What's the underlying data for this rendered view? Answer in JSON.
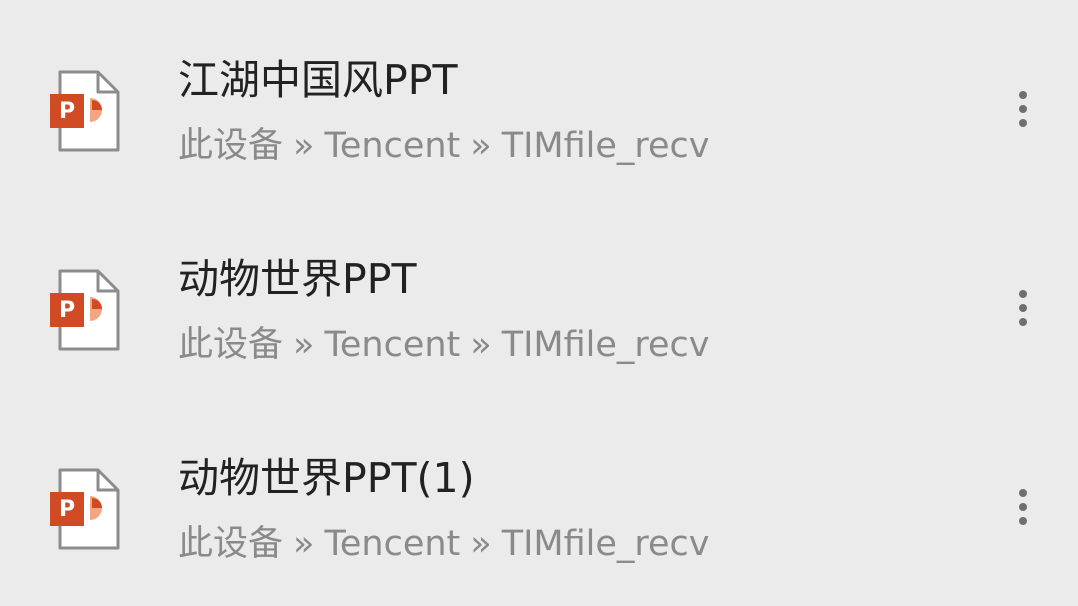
{
  "colors": {
    "background": "#ebebeb",
    "title_text": "#222222",
    "path_text": "#8a8a8a",
    "ppt_orange": "#d04a23",
    "ppt_light": "#f4a682"
  },
  "files": [
    {
      "icon": "ppt-file-icon",
      "name": "江湖中国风PPT",
      "path": [
        "此设备",
        "Tencent",
        "TIMfile_recv"
      ],
      "separator": "»",
      "menu_icon": "more-vert-icon"
    },
    {
      "icon": "ppt-file-icon",
      "name": "动物世界PPT",
      "path": [
        "此设备",
        "Tencent",
        "TIMfile_recv"
      ],
      "separator": "»",
      "menu_icon": "more-vert-icon"
    },
    {
      "icon": "ppt-file-icon",
      "name": "动物世界PPT(1)",
      "path": [
        "此设备",
        "Tencent",
        "TIMfile_recv"
      ],
      "separator": "»",
      "menu_icon": "more-vert-icon"
    }
  ]
}
